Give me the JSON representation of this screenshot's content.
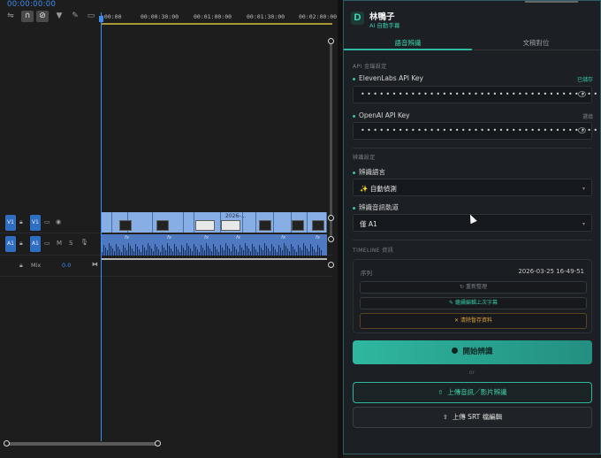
{
  "timeline": {
    "timecode": "00:00:00:00",
    "ruler_ticks": [
      ":00:00",
      "00:00:30:00",
      "00:01:00:00",
      "00:01:30:00",
      "00:02:00:00"
    ],
    "tools": [
      "ripple-icon",
      "magnet-icon",
      "linked-selection-icon",
      "marker-icon",
      "wrench-icon",
      "captions-icon"
    ],
    "tracks": {
      "v1_source": "V1",
      "v1_target": "V1",
      "a1_source": "A1",
      "a1_target": "A1",
      "mute": "M",
      "solo": "S",
      "mix_label": "Mix",
      "mix_value": "0.0"
    },
    "clip_label": "2026-...",
    "fx_label": "fx"
  },
  "panel": {
    "brand_name": "林鴨子",
    "brand_tagline": "AI 自動字幕",
    "tabs": [
      "語音辨識",
      "文稿對位"
    ],
    "api_section": "API 金鑰設定",
    "elevenlabs_label": "ElevenLabs API Key",
    "elevenlabs_hint": "已儲存",
    "elevenlabs_value": "••••••••••••••••••••••••••••••••••••••",
    "openai_label": "OpenAI API Key",
    "openai_hint": "選填",
    "openai_value": "••••••••••••••••••••••••••••••••••••••",
    "recog_section": "辨識設定",
    "language_label": "辨識語言",
    "language_value": "✨ 自動偵測",
    "track_label": "辨識音訊軌道",
    "track_value": "僅 A1",
    "timeline_section": "TIMELINE 資訊",
    "sequence_label": "序列",
    "sequence_value": "2026-03-25 16-49-51",
    "refresh_btn": "↻ 重新整理",
    "continue_btn": "✎ 繼續編輯上次字幕",
    "clear_btn": "✕ 清除暫存資料",
    "start_btn": "開始辨識",
    "or_text": "or",
    "upload_btn": "上傳音訊／影片辨識",
    "srt_btn": "上傳 SRT 檔編輯"
  },
  "colors": {
    "accent": "#2fb7a0",
    "playhead": "#3d8ef0",
    "video_clip": "#88aee6",
    "audio_clip": "#4f79c0"
  }
}
